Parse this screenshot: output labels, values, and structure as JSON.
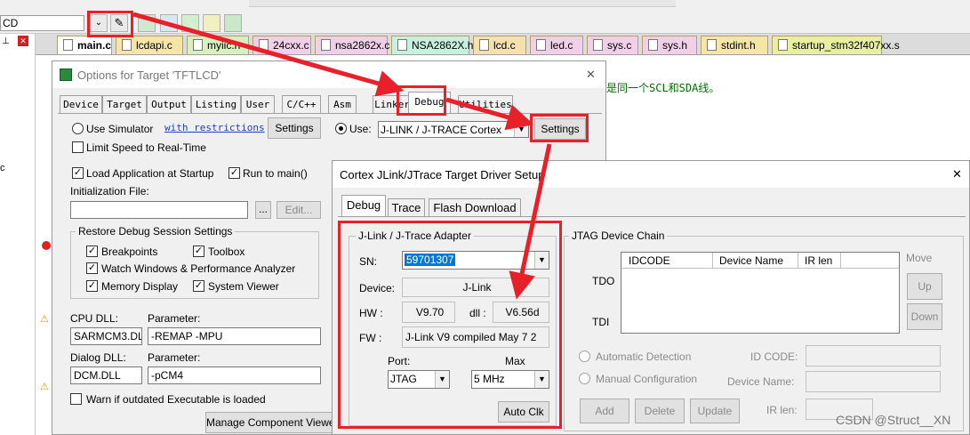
{
  "ide": {
    "left_combo_value": "CD",
    "editor_line_text": "是同一个SCL和SDA线。",
    "file_tabs": [
      {
        "label": "main.c",
        "color": "#f5e6a8"
      },
      {
        "label": "lcdapi.c",
        "color": "#f5e6a8"
      },
      {
        "label": "myiic.h",
        "color": "#d8f0c0"
      },
      {
        "label": "24cxx.c",
        "color": "#f0d0e8"
      },
      {
        "label": "nsa2862x.c",
        "color": "#f0d0e8"
      },
      {
        "label": "NSA2862X.h",
        "color": "#c8f0e0"
      },
      {
        "label": "lcd.c",
        "color": "#f5e0b0"
      },
      {
        "label": "led.c",
        "color": "#f0d0e8"
      },
      {
        "label": "sys.c",
        "color": "#f0d0e8"
      },
      {
        "label": "sys.h",
        "color": "#f0d0e8"
      },
      {
        "label": "stdint.h",
        "color": "#f5e6a8"
      },
      {
        "label": "startup_stm32f407xx.s",
        "color": "#e8f0a0"
      }
    ]
  },
  "options": {
    "title": "Options for Target 'TFTLCD'",
    "tabs": [
      "Device",
      "Target",
      "Output",
      "Listing",
      "User",
      "C/C++",
      "Asm",
      "Linker",
      "Debug",
      "Utilities"
    ],
    "use_simulator": "Use Simulator",
    "with_restrictions": "with restrictions",
    "settings_left": "Settings",
    "limit_speed": "Limit Speed to Real-Time",
    "use_label": "Use:",
    "use_value": "J-LINK / J-TRACE Cortex",
    "settings_right": "Settings",
    "load_app": "Load Application at Startup",
    "run_to_main": "Run to main()",
    "init_file": "Initialization File:",
    "browse": "...",
    "edit": "Edit...",
    "restore_group": "Restore Debug Session Settings",
    "breakpoints": "Breakpoints",
    "toolbox": "Toolbox",
    "watch_windows": "Watch Windows & Performance Analyzer",
    "memory_display": "Memory Display",
    "system_viewer": "System Viewer",
    "cpu_dll_label": "CPU DLL:",
    "cpu_param_label": "Parameter:",
    "cpu_dll_value": "SARMCM3.DLL",
    "cpu_param_value": "-REMAP -MPU",
    "dialog_dll_label": "Dialog DLL:",
    "dialog_param_label": "Parameter:",
    "dialog_dll_value": "DCM.DLL",
    "dialog_param_value": "-pCM4",
    "warn_outdated": "Warn if outdated Executable is loaded",
    "manage_component": "Manage Component Viewer"
  },
  "driver": {
    "title": "Cortex JLink/JTrace Target Driver Setup",
    "tabs": [
      "Debug",
      "Trace",
      "Flash Download"
    ],
    "adapter_group": "J-Link / J-Trace Adapter",
    "sn_label": "SN:",
    "sn_value": "59701307",
    "device_label": "Device:",
    "device_value": "J-Link",
    "hw_label": "HW :",
    "hw_value": "V9.70",
    "dll_label": "dll :",
    "dll_value": "V6.56d",
    "fw_label": "FW :",
    "fw_value": "J-Link V9 compiled May  7 2",
    "port_label": "Port:",
    "port_value": "JTAG",
    "max_label": "Max",
    "max_value": "5 MHz",
    "auto_clk": "Auto Clk",
    "jtag_group": "JTAG Device Chain",
    "col_idcode": "IDCODE",
    "col_device_name": "Device Name",
    "col_ir_len": "IR len",
    "tdo": "TDO",
    "tdi": "TDI",
    "move": "Move",
    "up": "Up",
    "down": "Down",
    "auto_detect": "Automatic Detection",
    "manual_config": "Manual Configuration",
    "id_code_label": "ID CODE:",
    "device_name_label": "Device Name:",
    "ir_len_label": "IR len:",
    "add": "Add",
    "delete": "Delete",
    "update": "Update",
    "close_glyph": "✕"
  },
  "watermark": "CSDN @Struct__XN"
}
